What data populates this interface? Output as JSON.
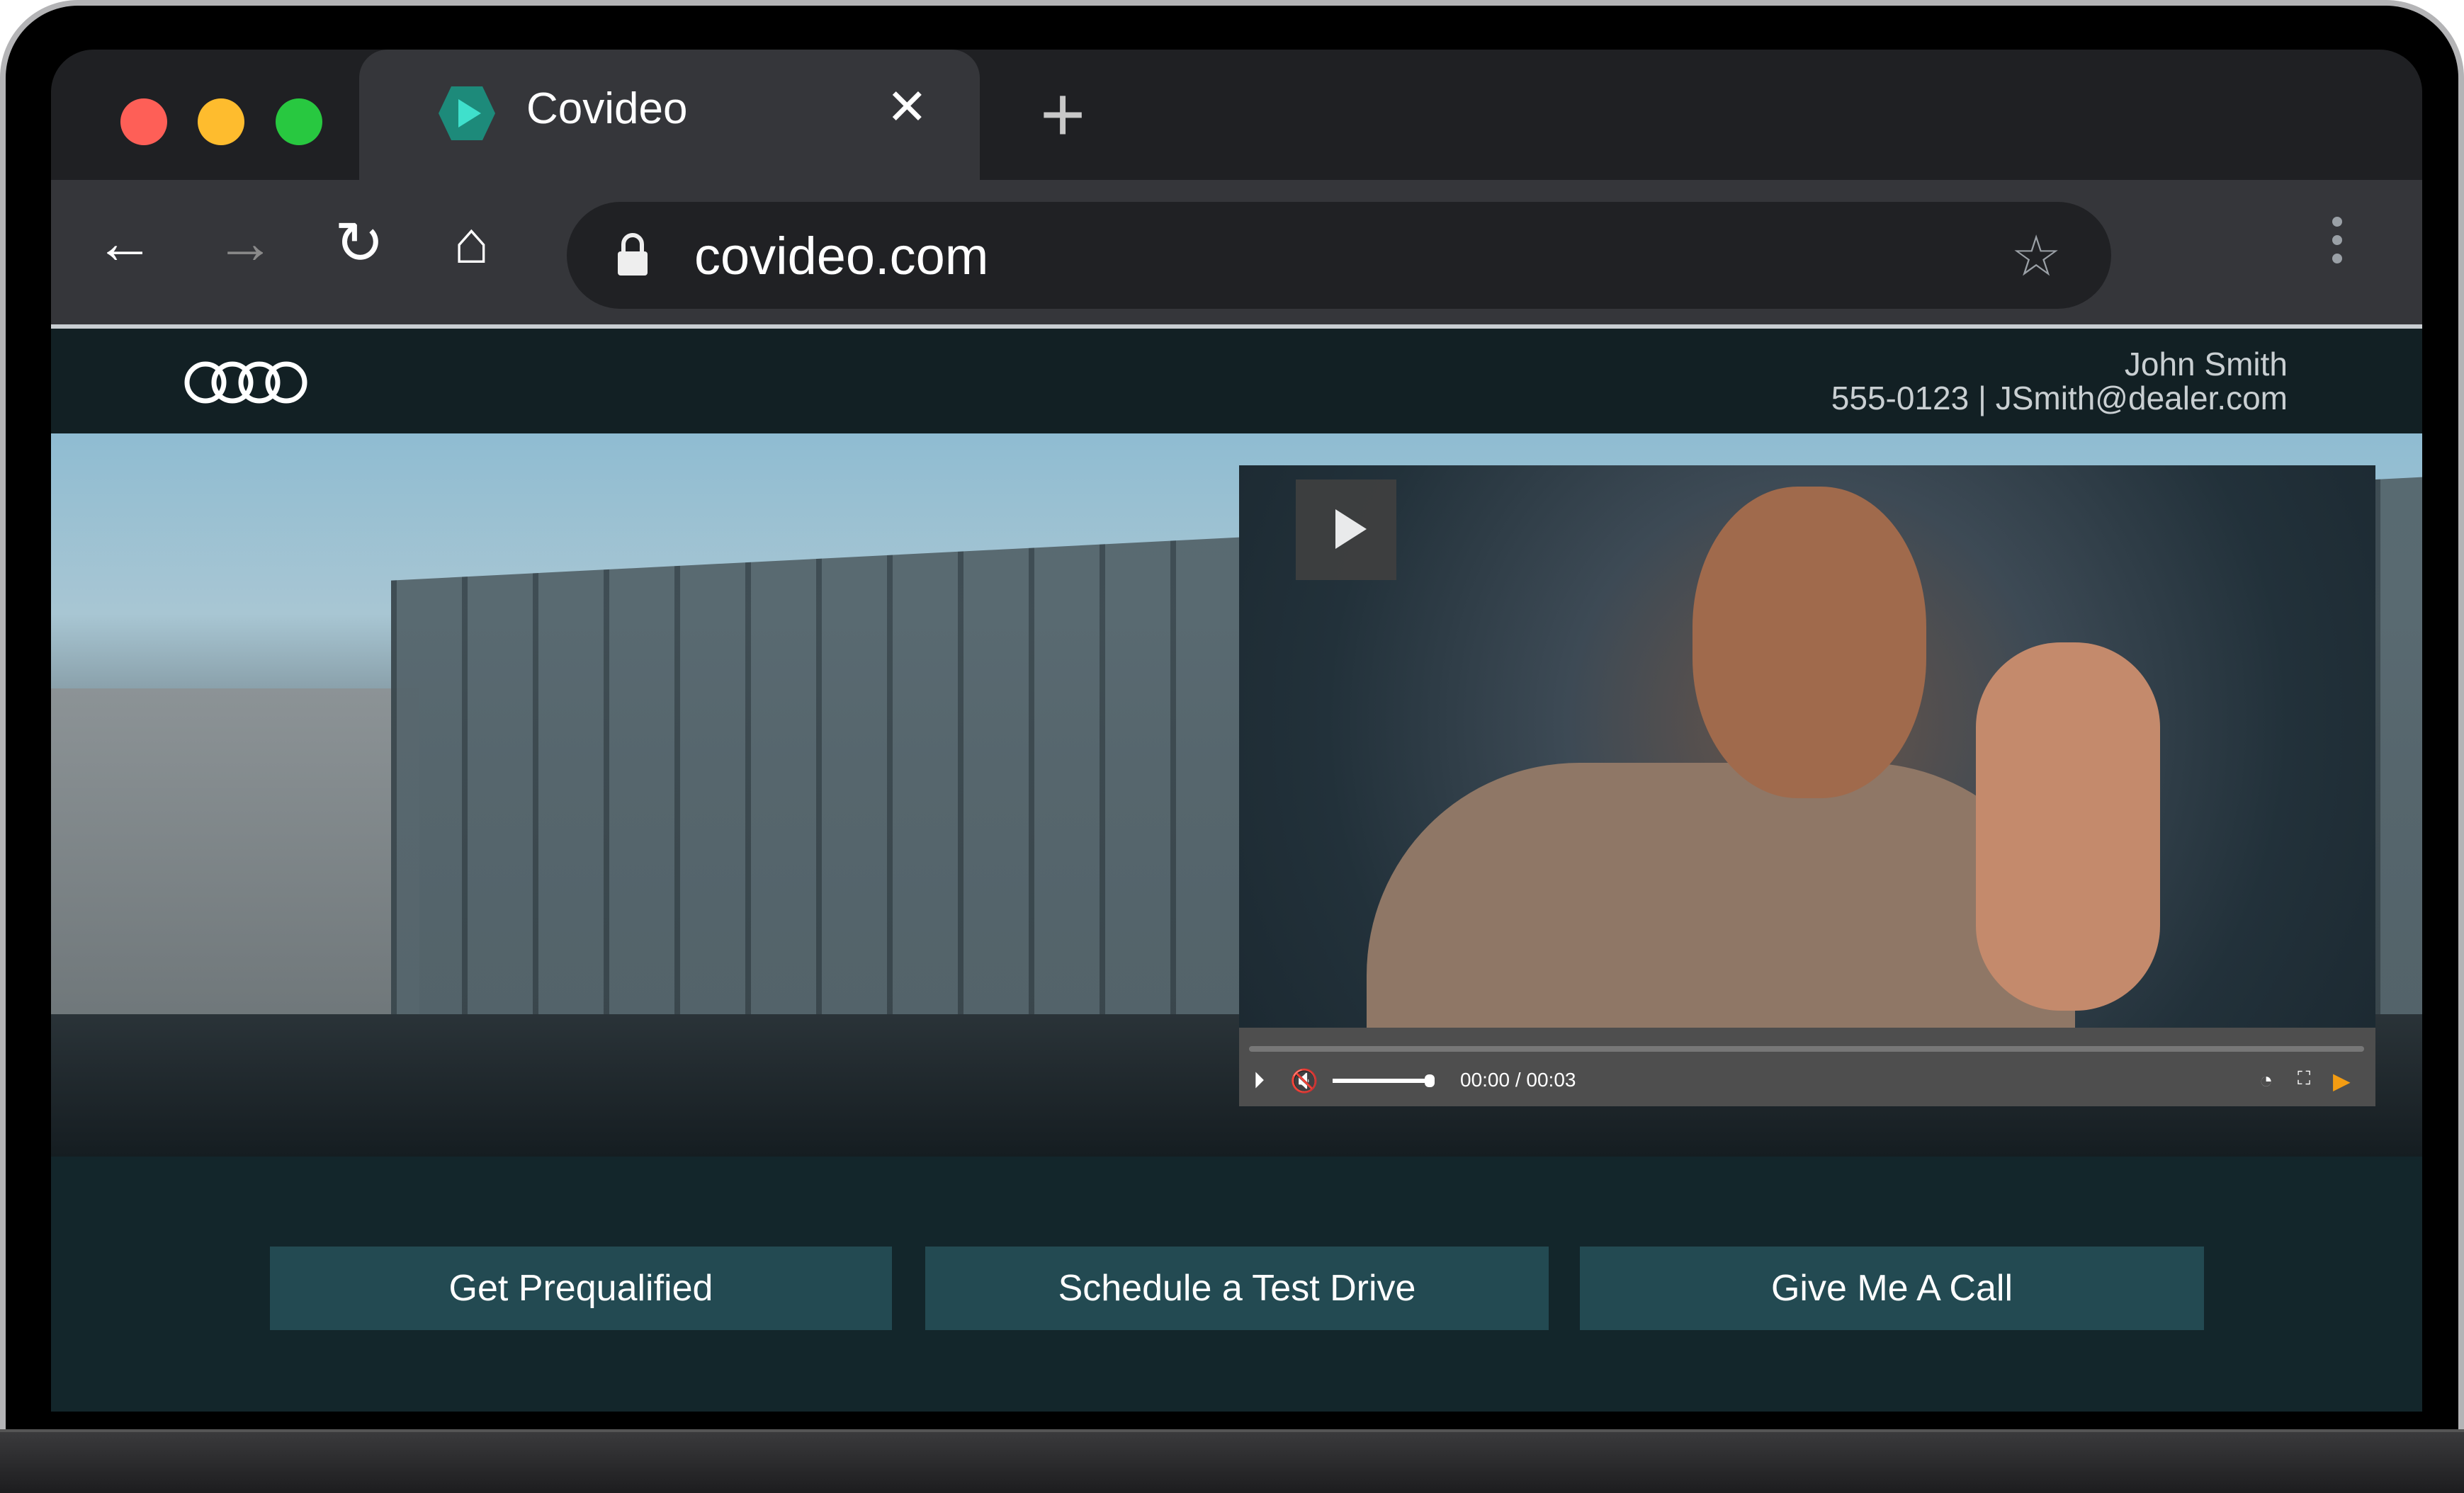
{
  "browser": {
    "tab_title": "Covideo",
    "close_glyph": "✕",
    "new_tab_glyph": "+",
    "url": "covideo.com",
    "icons": [
      "back-icon",
      "forward-icon",
      "reload-icon",
      "home-icon",
      "lock-icon",
      "star-icon",
      "kebab-menu-icon"
    ]
  },
  "header": {
    "logo": "four-rings-logo",
    "name": "John Smith",
    "contact": "555-0123 | JSmith@dealer.com"
  },
  "video": {
    "time": "00:00 / 00:03",
    "progress": 0,
    "volume": 1.0
  },
  "actions": [
    {
      "label": "Get Prequalified"
    },
    {
      "label": "Schedule a Test Drive"
    },
    {
      "label": "Give Me A Call"
    }
  ],
  "colors": {
    "button_bg": "#234a52",
    "page_bg": "#13262b",
    "header_bg": "#122024"
  }
}
